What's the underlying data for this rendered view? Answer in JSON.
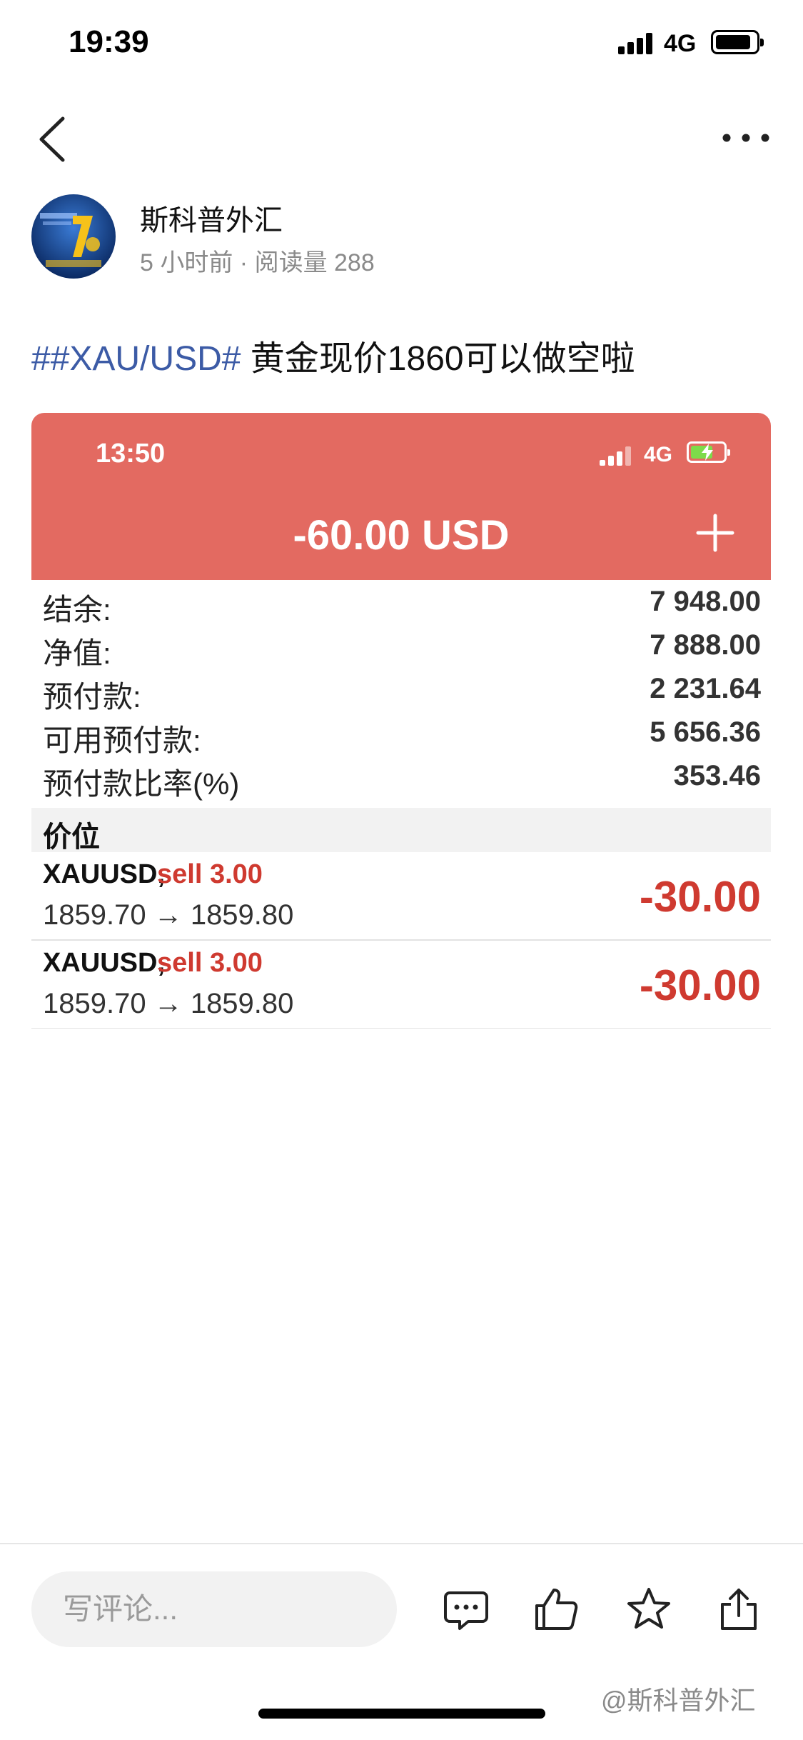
{
  "status_bar": {
    "time": "19:39",
    "network": "4G"
  },
  "author": {
    "name": "斯科普外汇",
    "meta": "5 小时前 · 阅读量 288"
  },
  "post": {
    "hashtag": "##XAU/USD#",
    "text": " 黄金现价1860可以做空啦"
  },
  "screenshot": {
    "status_time": "13:50",
    "network": "4G",
    "header_title": "-60.00 USD",
    "account_rows": [
      {
        "label": "结余:",
        "value": "7 948.00"
      },
      {
        "label": "净值:",
        "value": "7 888.00"
      },
      {
        "label": "预付款:",
        "value": "2 231.64"
      },
      {
        "label": "可用预付款:",
        "value": "5 656.36"
      },
      {
        "label": "预付款比率(%)",
        "value": "353.46"
      }
    ],
    "section_title": "价位",
    "positions": [
      {
        "symbol": "XAUUSD,",
        "side": "sell 3.00",
        "prices": "1859.70 → 1859.80",
        "profit": "-30.00"
      },
      {
        "symbol": "XAUUSD,",
        "side": "sell 3.00",
        "prices": "1859.70 → 1859.80",
        "profit": "-30.00"
      }
    ]
  },
  "bottom_bar": {
    "comment_placeholder": "写评论..."
  },
  "watermark": "@斯科普外汇",
  "colors": {
    "header_red": "#e36a61",
    "loss_red": "#cf3a30",
    "hashtag_blue": "#3c5ba6"
  },
  "icons": [
    "back-icon",
    "more-icon",
    "plus-icon",
    "comment-icon",
    "like-icon",
    "star-icon",
    "share-icon"
  ]
}
